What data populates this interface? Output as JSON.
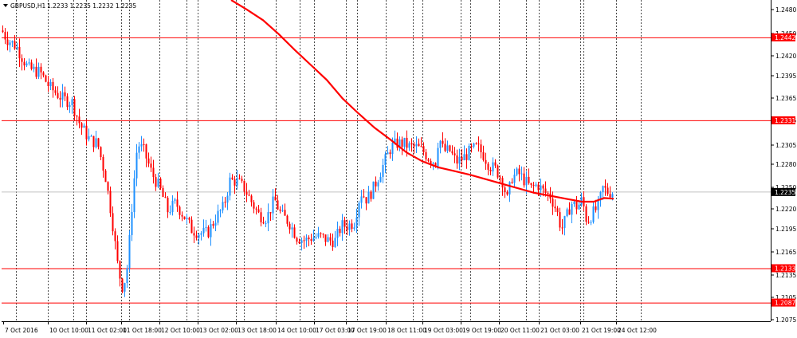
{
  "header": {
    "symbol_text": "GBPUSD,H1",
    "ohlc_text": "1.2233 1.2235 1.2232 1.2235"
  },
  "colors": {
    "background": "#ffffff",
    "bull_candle": "#1e90ff",
    "bear_candle": "#ff0000",
    "ma_line": "#ff0000",
    "level_line": "#ff0000",
    "grid": "#000000",
    "price_line": "#c0c0c0",
    "price_badge": "#000000"
  },
  "chart_data": {
    "type": "candlestick",
    "symbol": "GBPUSD",
    "timeframe": "H1",
    "ylim": [
      1.2062,
      1.2492
    ],
    "y_ticks": [
      "1.2480",
      "1.2450",
      "1.2420",
      "1.2395",
      "1.2365",
      "1.2335",
      "1.2305",
      "1.2280",
      "1.2250",
      "1.2220",
      "1.2195",
      "1.2165",
      "1.2135",
      "1.2105",
      "1.2075"
    ],
    "x_ticks": [
      "7 Oct 2016",
      "10 Oct 10:00",
      "11 Oct 02:00",
      "11 Oct 18:00",
      "12 Oct 10:00",
      "13 Oct 02:00",
      "13 Oct 18:00",
      "14 Oct 10:00",
      "17 Oct 03:00",
      "17 Oct 19:00",
      "18 Oct 11:00",
      "19 Oct 03:00",
      "19 Oct 19:00",
      "20 Oct 11:00",
      "21 Oct 03:00",
      "21 Oct 19:00",
      "24 Oct 12:00"
    ],
    "grid": "vertical dotted",
    "horizontal_levels": [
      {
        "value": 1.2442,
        "label": "1.2442"
      },
      {
        "value": 1.2331,
        "label": "1.2331"
      },
      {
        "value": 1.2133,
        "label": "1.2133"
      },
      {
        "value": 1.2087,
        "label": "1.2087"
      }
    ],
    "current_price": {
      "value": 1.2235,
      "label": "1.2235"
    },
    "close_path": [
      [
        0,
        1.2455
      ],
      [
        8,
        1.244
      ],
      [
        20,
        1.243
      ],
      [
        35,
        1.24
      ],
      [
        50,
        1.2395
      ],
      [
        62,
        1.2375
      ],
      [
        78,
        1.236
      ],
      [
        90,
        1.2355
      ],
      [
        100,
        1.2325
      ],
      [
        112,
        1.2305
      ],
      [
        122,
        1.23
      ],
      [
        132,
        1.2255
      ],
      [
        140,
        1.22
      ],
      [
        148,
        1.213
      ],
      [
        154,
        1.2105
      ],
      [
        160,
        1.214
      ],
      [
        166,
        1.223
      ],
      [
        172,
        1.23
      ],
      [
        180,
        1.229
      ],
      [
        190,
        1.226
      ],
      [
        200,
        1.224
      ],
      [
        210,
        1.221
      ],
      [
        220,
        1.222
      ],
      [
        232,
        1.22
      ],
      [
        240,
        1.2185
      ],
      [
        250,
        1.218
      ],
      [
        260,
        1.218
      ],
      [
        270,
        1.22
      ],
      [
        280,
        1.2215
      ],
      [
        288,
        1.225
      ],
      [
        296,
        1.225
      ],
      [
        306,
        1.224
      ],
      [
        316,
        1.222
      ],
      [
        324,
        1.2205
      ],
      [
        334,
        1.22
      ],
      [
        344,
        1.2225
      ],
      [
        352,
        1.2205
      ],
      [
        362,
        1.2195
      ],
      [
        372,
        1.2175
      ],
      [
        382,
        1.217
      ],
      [
        392,
        1.2175
      ],
      [
        402,
        1.2175
      ],
      [
        412,
        1.217
      ],
      [
        420,
        1.217
      ],
      [
        428,
        1.219
      ],
      [
        436,
        1.219
      ],
      [
        444,
        1.2195
      ],
      [
        452,
        1.2235
      ],
      [
        460,
        1.2225
      ],
      [
        468,
        1.224
      ],
      [
        476,
        1.226
      ],
      [
        484,
        1.228
      ],
      [
        490,
        1.2295
      ],
      [
        498,
        1.23
      ],
      [
        506,
        1.23
      ],
      [
        514,
        1.2295
      ],
      [
        522,
        1.2295
      ],
      [
        530,
        1.229
      ],
      [
        538,
        1.228
      ],
      [
        546,
        1.2275
      ],
      [
        550,
        1.231
      ],
      [
        556,
        1.229
      ],
      [
        564,
        1.229
      ],
      [
        572,
        1.2275
      ],
      [
        580,
        1.228
      ],
      [
        590,
        1.229
      ],
      [
        598,
        1.2295
      ],
      [
        606,
        1.2285
      ],
      [
        614,
        1.227
      ],
      [
        622,
        1.2265
      ],
      [
        630,
        1.225
      ],
      [
        636,
        1.2225
      ],
      [
        642,
        1.2255
      ],
      [
        650,
        1.226
      ],
      [
        658,
        1.225
      ],
      [
        666,
        1.224
      ],
      [
        674,
        1.2245
      ],
      [
        682,
        1.2235
      ],
      [
        690,
        1.223
      ],
      [
        698,
        1.221
      ],
      [
        704,
        1.2185
      ],
      [
        710,
        1.22
      ],
      [
        716,
        1.222
      ],
      [
        724,
        1.2215
      ],
      [
        730,
        1.2225
      ],
      [
        736,
        1.2195
      ],
      [
        742,
        1.2205
      ],
      [
        750,
        1.2215
      ],
      [
        756,
        1.224
      ],
      [
        762,
        1.2235
      ],
      [
        768,
        1.2235
      ]
    ],
    "ma_path": [
      [
        290,
        1.2492
      ],
      [
        310,
        1.2479
      ],
      [
        330,
        1.2465
      ],
      [
        350,
        1.2446
      ],
      [
        370,
        1.2425
      ],
      [
        390,
        1.2405
      ],
      [
        410,
        1.2385
      ],
      [
        430,
        1.236
      ],
      [
        450,
        1.234
      ],
      [
        470,
        1.2321
      ],
      [
        490,
        1.2305
      ],
      [
        510,
        1.2288
      ],
      [
        530,
        1.2276
      ],
      [
        550,
        1.2268
      ],
      [
        570,
        1.2263
      ],
      [
        590,
        1.2258
      ],
      [
        610,
        1.2252
      ],
      [
        630,
        1.2246
      ],
      [
        650,
        1.224
      ],
      [
        670,
        1.2234
      ],
      [
        690,
        1.223
      ],
      [
        710,
        1.2226
      ],
      [
        730,
        1.2222
      ],
      [
        745,
        1.2222
      ],
      [
        758,
        1.2227
      ],
      [
        770,
        1.2226
      ]
    ]
  }
}
